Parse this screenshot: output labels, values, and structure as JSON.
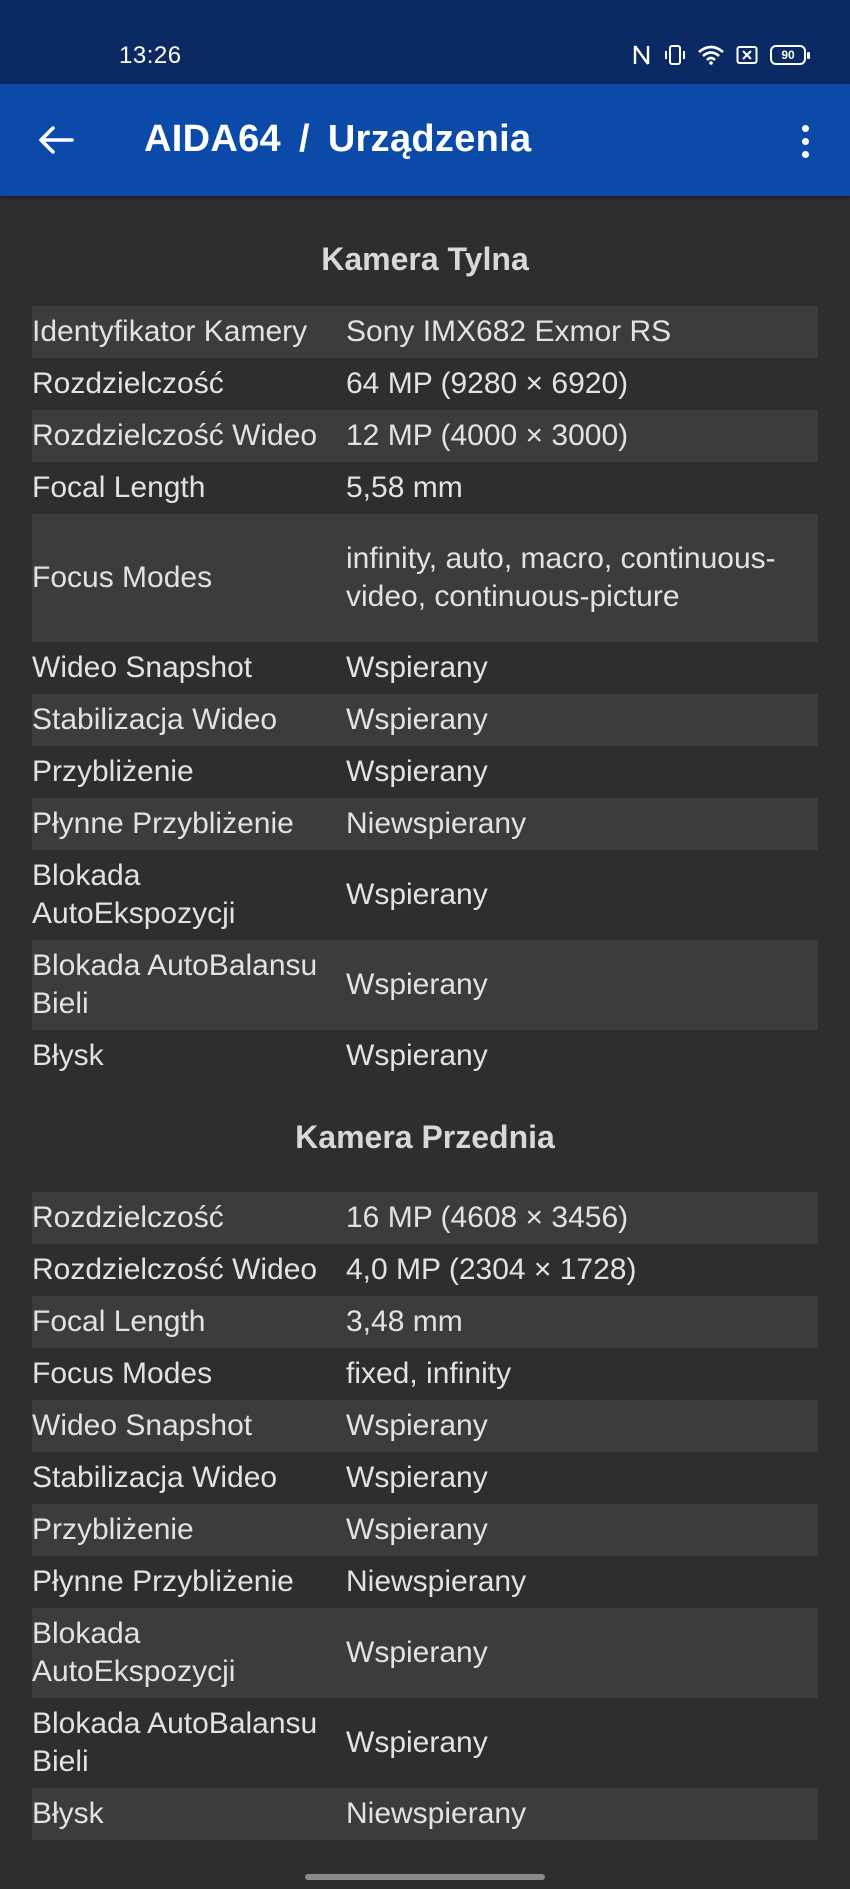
{
  "status": {
    "time": "13:26",
    "battery": "90"
  },
  "appbar": {
    "app_name": "AIDA64",
    "separator": "/",
    "page": "Urządzenia"
  },
  "rear": {
    "title": "Kamera Tylna",
    "rows": [
      {
        "label": "Identyfikator Kamery",
        "value": "Sony IMX682 Exmor RS"
      },
      {
        "label": "Rozdzielczość",
        "value": "64 MP (9280 × 6920)"
      },
      {
        "label": "Rozdzielczość Wideo",
        "value": "12 MP (4000 × 3000)"
      },
      {
        "label": "Focal Length",
        "value": "5,58 mm"
      },
      {
        "label": "Focus Modes",
        "value": "infinity, auto, macro, continuous-video, continuous-picture"
      },
      {
        "label": "Wideo Snapshot",
        "value": "Wspierany"
      },
      {
        "label": "Stabilizacja Wideo",
        "value": "Wspierany"
      },
      {
        "label": "Przybliżenie",
        "value": "Wspierany"
      },
      {
        "label": "Płynne Przybliżenie",
        "value": "Niewspierany"
      },
      {
        "label": "Blokada AutoEkspozycji",
        "value": "Wspierany"
      },
      {
        "label": "Blokada AutoBalansu Bieli",
        "value": "Wspierany"
      },
      {
        "label": "Błysk",
        "value": "Wspierany"
      }
    ]
  },
  "front": {
    "title": "Kamera Przednia",
    "rows": [
      {
        "label": "Rozdzielczość",
        "value": "16 MP (4608 × 3456)"
      },
      {
        "label": "Rozdzielczość Wideo",
        "value": "4,0 MP (2304 × 1728)"
      },
      {
        "label": "Focal Length",
        "value": "3,48 mm"
      },
      {
        "label": "Focus Modes",
        "value": "fixed, infinity"
      },
      {
        "label": "Wideo Snapshot",
        "value": "Wspierany"
      },
      {
        "label": "Stabilizacja Wideo",
        "value": "Wspierany"
      },
      {
        "label": "Przybliżenie",
        "value": "Wspierany"
      },
      {
        "label": "Płynne Przybliżenie",
        "value": "Niewspierany"
      },
      {
        "label": "Blokada AutoEkspozycji",
        "value": "Wspierany"
      },
      {
        "label": "Blokada AutoBalansu Bieli",
        "value": "Wspierany"
      },
      {
        "label": "Błysk",
        "value": "Niewspierany"
      }
    ]
  },
  "colors": {
    "statusbar": "#0b2a63",
    "appbar": "#0b4aa8",
    "background": "#2e2d30",
    "row_alt": "#3c3b3e"
  }
}
